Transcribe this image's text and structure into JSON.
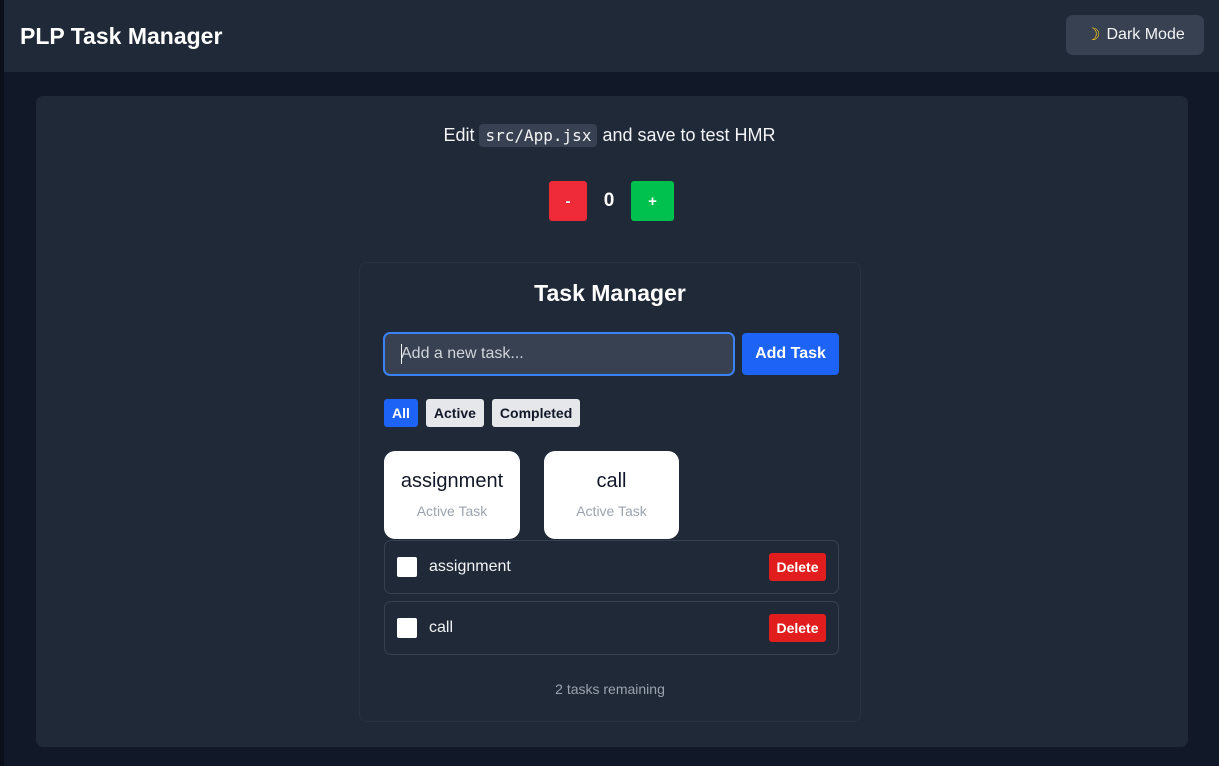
{
  "header": {
    "title": "PLP Task Manager",
    "mode_icon": "moon-icon",
    "mode_label": "Dark Mode"
  },
  "hmr": {
    "prefix": "Edit",
    "code": "src/App.jsx",
    "suffix": "and save to test HMR"
  },
  "counter": {
    "minus_label": "-",
    "value": "0",
    "plus_label": "+"
  },
  "task_manager": {
    "title": "Task Manager",
    "input_placeholder": "Add a new task...",
    "add_label": "Add Task",
    "filters": [
      {
        "label": "All",
        "active": true
      },
      {
        "label": "Active",
        "active": false
      },
      {
        "label": "Completed",
        "active": false
      }
    ],
    "chips": [
      {
        "title": "assignment",
        "subtitle": "Active Task"
      },
      {
        "title": "call",
        "subtitle": "Active Task"
      }
    ],
    "tasks": [
      {
        "label": "assignment",
        "completed": false,
        "delete_label": "Delete"
      },
      {
        "label": "call",
        "completed": false,
        "delete_label": "Delete"
      }
    ],
    "remaining": "2 tasks remaining"
  },
  "colors": {
    "accent": "#1d63f5",
    "danger": "#e11d1d",
    "success": "#00c14e",
    "background": "#111827",
    "surface": "#1f2937"
  }
}
